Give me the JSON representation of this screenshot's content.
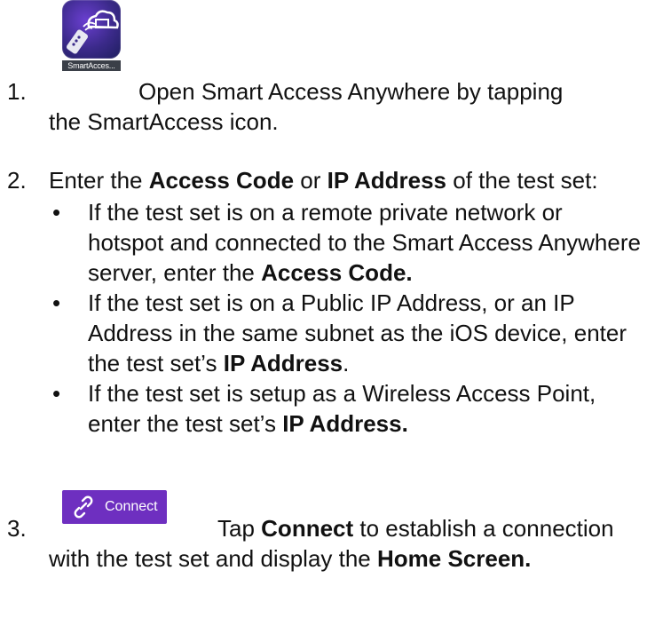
{
  "step1": {
    "number": "1.",
    "icon_caption": "SmartAcces...",
    "line1": "Open Smart Access Anywhere by tapping",
    "line2": "the SmartAccess icon."
  },
  "step2": {
    "number": "2.",
    "intro_pre": "Enter the ",
    "intro_b1": "Access Code",
    "intro_mid": " or ",
    "intro_b2": "IP Address",
    "intro_post": " of the test set:",
    "bullets": [
      {
        "text": "If the test set is on a remote private network or hotspot and connected to the Smart Access Anywhere server, enter the ",
        "bold": "Access Code.",
        "tail": ""
      },
      {
        "text": "If the test set is on a Public IP Address, or an IP Address in the same subnet as the iOS device, enter the test set’s ",
        "bold": "IP Address",
        "tail": "."
      },
      {
        "text": "If the test set is setup as a Wireless Access Point, enter the test set’s ",
        "bold": "IP Address.",
        "tail": ""
      }
    ]
  },
  "step3": {
    "number": "3.",
    "button_label": "Connect",
    "pre": "Tap ",
    "bold1": "Connect",
    "mid": " to establish a connection with the test set and display the ",
    "bold2": "Home Screen."
  },
  "colors": {
    "connect_button": "#6e2fc0",
    "app_icon": "#3b2a8a"
  },
  "icons": {
    "app_icon": "smartaccess-app-icon",
    "connect_icon": "link-icon",
    "bullet": "bullet-dot"
  }
}
